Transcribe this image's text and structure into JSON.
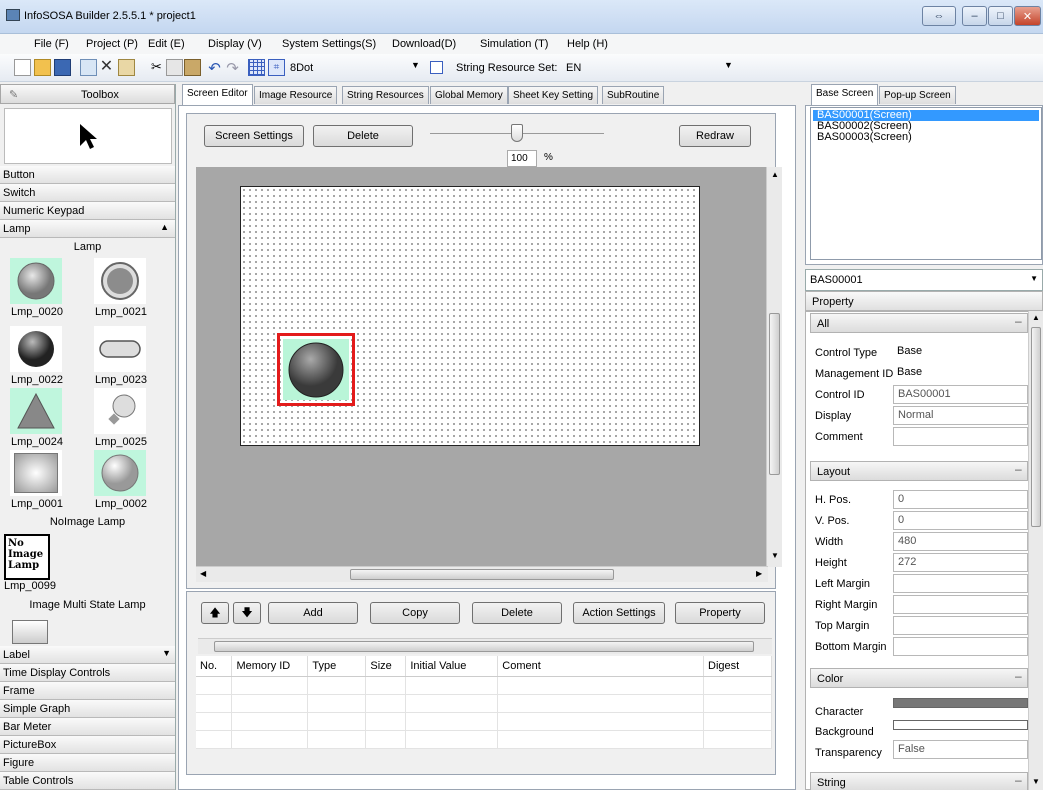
{
  "window": {
    "title": "InfoSOSA Builder 2.5.5.1 * project1"
  },
  "menu": [
    "File (F)",
    "Project (P)",
    "Edit (E)",
    "Display (V)",
    "System Settings(S)",
    "Download(D)",
    "Simulation (T)",
    "Help (H)"
  ],
  "toolbar": {
    "grid_value": "8Dot",
    "string_resource_label": "String Resource Set:",
    "string_resource_value": "EN"
  },
  "toolbox": {
    "title": "Toolbox",
    "categories_top": [
      "Button",
      "Switch",
      "Numeric Keypad",
      "Lamp"
    ],
    "lamp_section": "Lamp",
    "lamps": [
      "Lmp_0020",
      "Lmp_0021",
      "Lmp_0022",
      "Lmp_0023",
      "Lmp_0024",
      "Lmp_0025",
      "Lmp_0001",
      "Lmp_0002"
    ],
    "noimage_section": "NoImage Lamp",
    "noimage_text": "No\nImage\nLamp",
    "noimage_id": "Lmp_0099",
    "multistate_section": "Image Multi State Lamp",
    "categories_bottom": [
      "Label",
      "Time Display Controls",
      "Frame",
      "Simple Graph",
      "Bar Meter",
      "PictureBox",
      "Figure",
      "Table Controls"
    ]
  },
  "tabs": [
    "Screen Editor",
    "Image Resource",
    "String Resources",
    "Global Memory",
    "Sheet Key Setting",
    "SubRoutine"
  ],
  "editor": {
    "screen_settings": "Screen Settings",
    "delete": "Delete",
    "zoom": "100",
    "zoom_unit": "%",
    "redraw": "Redraw"
  },
  "memory": {
    "buttons": {
      "add": "Add",
      "copy": "Copy",
      "delete": "Delete",
      "action": "Action Settings",
      "property": "Property"
    },
    "columns": [
      "No.",
      "Memory ID",
      "Type",
      "Size",
      "Initial Value",
      "Coment",
      "Digest"
    ]
  },
  "right_tabs": [
    "Base Screen",
    "Pop-up Screen"
  ],
  "screens": [
    "BAS00001(Screen)",
    "BAS00002(Screen)",
    "BAS00003(Screen)"
  ],
  "selected_object": "BAS00001",
  "property_title": "Property",
  "sections": {
    "all": "All",
    "layout": "Layout",
    "color": "Color",
    "string": "String"
  },
  "props_all": [
    {
      "label": "Control Type",
      "value": "Base"
    },
    {
      "label": "Management ID",
      "value": "Base"
    },
    {
      "label": "Control ID",
      "value": "BAS00001"
    },
    {
      "label": "Display",
      "value": "Normal"
    },
    {
      "label": "Comment",
      "value": ""
    }
  ],
  "props_layout": [
    {
      "label": "H. Pos.",
      "value": "0"
    },
    {
      "label": "V. Pos.",
      "value": "0"
    },
    {
      "label": "Width",
      "value": "480"
    },
    {
      "label": "Height",
      "value": "272"
    },
    {
      "label": "Left Margin",
      "value": ""
    },
    {
      "label": "Right Margin",
      "value": ""
    },
    {
      "label": "Top Margin",
      "value": ""
    },
    {
      "label": "Bottom Margin",
      "value": ""
    }
  ],
  "props_color": [
    {
      "label": "Character",
      "value": ""
    },
    {
      "label": "Background",
      "value": ""
    },
    {
      "label": "Transparency",
      "value": "False"
    }
  ],
  "colors": {
    "selection": "#3399ff",
    "highlight": "#e31b1b",
    "lamp_bg": "#b9f5d8"
  }
}
